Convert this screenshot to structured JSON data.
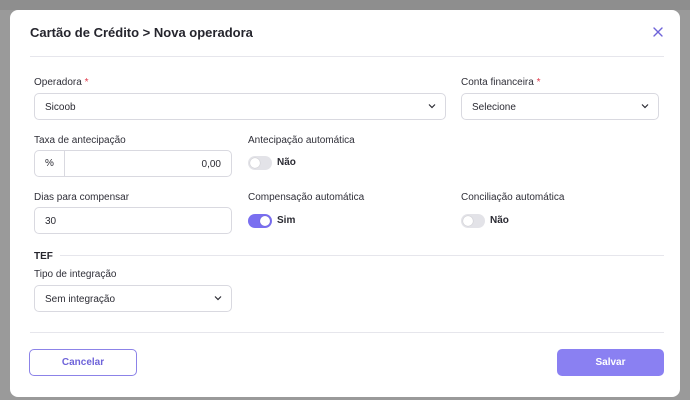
{
  "modal": {
    "title": "Cartão de Crédito > Nova operadora",
    "close_icon": "close-icon"
  },
  "form": {
    "operadora": {
      "label": "Operadora",
      "required_mark": "*",
      "value": "Sicoob"
    },
    "conta_financeira": {
      "label": "Conta financeira",
      "required_mark": "*",
      "value": "Selecione"
    },
    "taxa_antecipacao": {
      "label": "Taxa de antecipação",
      "prefix": "%",
      "value": "0,00"
    },
    "antecipacao_automatica": {
      "label": "Antecipação automática",
      "state_text": "Não",
      "on": false
    },
    "dias_compensar": {
      "label": "Dias para compensar",
      "value": "30"
    },
    "compensacao_automatica": {
      "label": "Compensação automática",
      "state_text": "Sim",
      "on": true
    },
    "conciliacao_automatica": {
      "label": "Conciliação automática",
      "state_text": "Não",
      "on": false
    },
    "tef": {
      "section_title": "TEF",
      "tipo_integracao": {
        "label": "Tipo de integração",
        "value": "Sem integração"
      }
    }
  },
  "footer": {
    "cancel_label": "Cancelar",
    "save_label": "Salvar"
  },
  "colors": {
    "accent": "#7a6ff0",
    "required": "#e0394a"
  }
}
